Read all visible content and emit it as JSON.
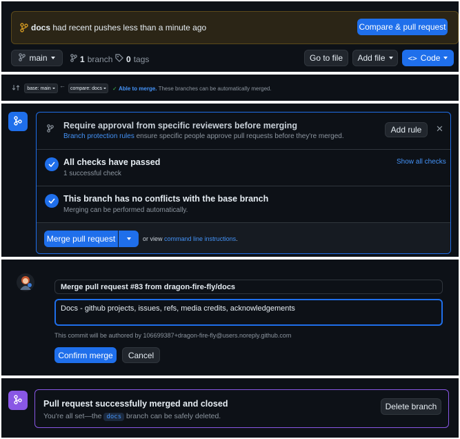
{
  "push_banner": {
    "branch": "docs",
    "text": "had recent pushes less than a minute ago",
    "compare_button": "Compare & pull request"
  },
  "repo_bar": {
    "branch_select": "main",
    "branch_count": "1",
    "branch_label": "branch",
    "tag_count": "0",
    "tag_label": "tags",
    "go_to_file": "Go to file",
    "add_file": "Add file",
    "code": "Code"
  },
  "compare_bar": {
    "base": "base: main",
    "compare": "compare: docs",
    "able": "Able to merge.",
    "able_detail": "These branches can be automatically merged."
  },
  "merge_box": {
    "approval_title": "Require approval from specific reviewers before merging",
    "protection_link": "Branch protection rules",
    "protection_text": "ensure specific people approve pull requests before they're merged.",
    "add_rule": "Add rule",
    "checks_title": "All checks have passed",
    "checks_sub": "1 successful check",
    "show_checks": "Show all checks",
    "conflicts_title": "This branch has no conflicts with the base branch",
    "conflicts_sub": "Merging can be performed automatically.",
    "merge_button": "Merge pull request",
    "or_view": "or view",
    "cli_link": "command line instructions",
    "period": "."
  },
  "confirm": {
    "title_value": "Merge pull request #83 from dragon-fire-fly/docs",
    "body_value": "Docs - github projects, issues, refs, media credits, acknowledgements",
    "author_note": "This commit will be authored by 106699387+dragon-fire-fly@users.noreply.github.com",
    "confirm_button": "Confirm merge",
    "cancel_button": "Cancel"
  },
  "merged": {
    "title": "Pull request successfully merged and closed",
    "text_before": "You're all set—the",
    "branch": "docs",
    "text_after": "branch can be safely deleted.",
    "delete_button": "Delete branch"
  },
  "colors": {
    "bg": "#0d1117",
    "blue": "#1f6feb",
    "link": "#4493f8",
    "purple": "#8957e5",
    "warn_bg": "#2b2516",
    "warn_border": "#5c4a1a",
    "warn_icon": "#d29922"
  }
}
